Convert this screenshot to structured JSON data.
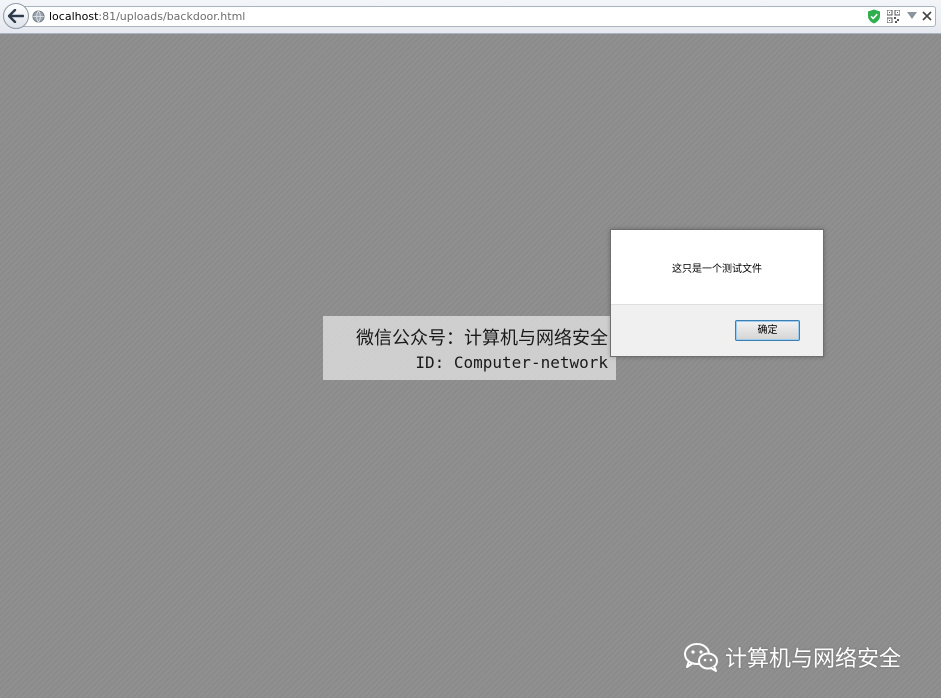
{
  "browser": {
    "url_host": "localhost",
    "url_rest": ":81/uploads/backdoor.html",
    "icons": [
      "back-arrow-icon",
      "globe-icon",
      "shield-icon",
      "qr-code-icon",
      "dropdown-icon",
      "close-icon"
    ]
  },
  "dialog": {
    "message": "这只是一个测试文件",
    "ok_label": "确定"
  },
  "watermark": {
    "line1": "微信公众号：计算机与网络安全",
    "line2": "ID: Computer-network",
    "corner_text": "计算机与网络安全"
  },
  "colors": {
    "overlay": "#8c8d8c",
    "shield": "#2fae4e",
    "button_border": "#3c7fb1"
  }
}
